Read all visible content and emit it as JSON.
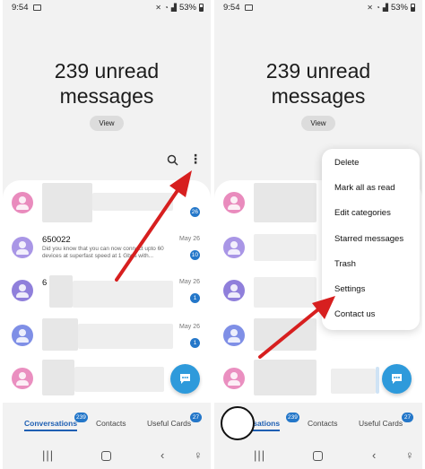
{
  "status": {
    "time": "9:54",
    "battery": "53%"
  },
  "headline": {
    "line1": "239 unread",
    "line2": "messages"
  },
  "view_label": "View",
  "conversations": [
    {
      "name": "",
      "preview": "",
      "date": "",
      "badge": "26"
    },
    {
      "name": "650022",
      "preview": "Did you know that you can now connect upto 60 devices at superfast speed at 1 Gbps with...",
      "date": "May 26",
      "badge": "10"
    },
    {
      "name": "6",
      "preview": "",
      "date": "May 26",
      "badge": "1"
    },
    {
      "name": "",
      "preview": "",
      "date": "May 26",
      "badge": "1"
    },
    {
      "name": "",
      "preview": "",
      "date": "",
      "badge": ""
    }
  ],
  "tabs": {
    "conversations": {
      "label": "Conversations",
      "count": "239",
      "label_clipped": "rsations"
    },
    "contacts": {
      "label": "Contacts"
    },
    "useful_cards": {
      "label": "Useful Cards",
      "count": "27"
    }
  },
  "menu": {
    "items": [
      "Delete",
      "Mark all as read",
      "Edit categories",
      "Starred messages",
      "Trash",
      "Settings",
      "Contact us"
    ]
  },
  "colors": {
    "accent": "#1e5fb3",
    "badge": "#2477c9",
    "fab": "#2e9adb",
    "arrow": "#d71f1f",
    "avatars": [
      "#e98bbd",
      "#a996e6",
      "#8f7fdb",
      "#7f8fe6",
      "#ea8fc0"
    ]
  },
  "icons": [
    "search-icon",
    "more-options-icon",
    "compose-icon",
    "recent-apps-icon",
    "home-icon",
    "back-icon",
    "accessibility-icon"
  ]
}
